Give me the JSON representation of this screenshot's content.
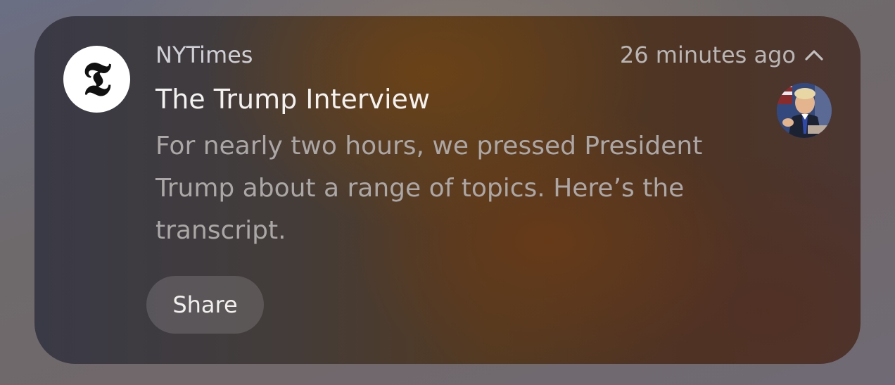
{
  "notification": {
    "app_icon": "nytimes-t-logo",
    "app_icon_glyph": "𝕿",
    "app_name": "NYTimes",
    "timestamp": "26 minutes ago",
    "collapse_icon": "chevron-up-icon",
    "title": "The Trump Interview",
    "body": "For nearly two hours, we pressed President Trump about a range of topics. Here’s the transcript.",
    "thumbnail": "news-photo-thumbnail",
    "actions": {
      "share_label": "Share"
    }
  }
}
